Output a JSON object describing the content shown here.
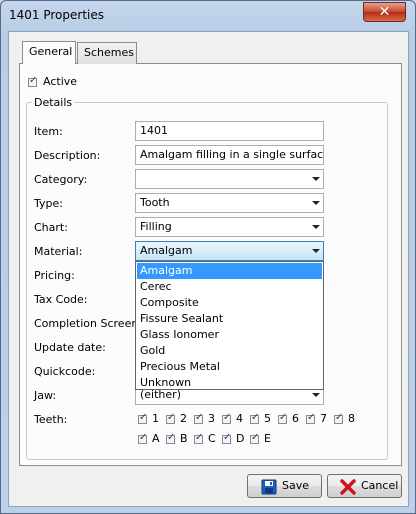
{
  "window": {
    "title": "1401 Properties",
    "close_glyph": "✕"
  },
  "tabs": [
    {
      "label": "General",
      "selected": true
    },
    {
      "label": "Schemes",
      "selected": false
    }
  ],
  "active": {
    "label": "Active",
    "checked": true
  },
  "details": {
    "group_label": "Details",
    "item": {
      "label": "Item:",
      "value": "1401"
    },
    "description": {
      "label": "Description:",
      "value": "Amalgam filling in a single surface"
    },
    "category": {
      "label": "Category:",
      "value": ""
    },
    "type": {
      "label": "Type:",
      "value": "Tooth"
    },
    "chart": {
      "label": "Chart:",
      "value": "Filling"
    },
    "material": {
      "label": "Material:",
      "value": "Amalgam",
      "options": [
        "Amalgam",
        "Cerec",
        "Composite",
        "Fissure Sealant",
        "Glass Ionomer",
        "Gold",
        "Precious Metal",
        "Unknown"
      ],
      "selected_index": 0
    },
    "pricing": {
      "label": "Pricing:"
    },
    "tax_code": {
      "label": "Tax Code:"
    },
    "completion_screen": {
      "label": "Completion Screen:"
    },
    "update_date": {
      "label": "Update date:"
    },
    "quickcode": {
      "label": "Quickcode:"
    },
    "jaw": {
      "label": "Jaw:",
      "value": "(either)"
    },
    "teeth": {
      "label": "Teeth:",
      "numbers": [
        "1",
        "2",
        "3",
        "4",
        "5",
        "6",
        "7",
        "8"
      ],
      "letters": [
        "A",
        "B",
        "C",
        "D",
        "E"
      ]
    }
  },
  "buttons": {
    "save": "Save",
    "cancel": "Cancel"
  },
  "colors": {
    "selection": "#3399ff",
    "close_button": "#c7462b",
    "checkmark": "#2b3b8c"
  }
}
